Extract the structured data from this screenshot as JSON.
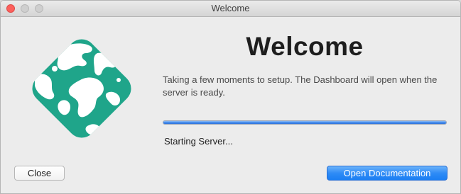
{
  "window": {
    "title": "Welcome"
  },
  "main": {
    "heading": "Welcome",
    "message": "Taking a few moments to setup. The Dashboard will open when the server is ready.",
    "progress_percent": 100,
    "status": "Starting Server..."
  },
  "buttons": {
    "close_label": "Close",
    "open_docs_label": "Open Documentation"
  },
  "colors": {
    "logo": "#1fa58a",
    "accent": "#2f8cf6"
  },
  "icons": {
    "logo": "globe-logo-icon"
  }
}
